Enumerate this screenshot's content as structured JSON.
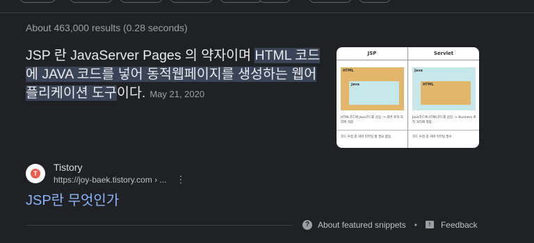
{
  "stats": "About 463,000 results (0.28 seconds)",
  "snippet": {
    "text_plain": "JSP 란 JavaServer Pages 의 약자이며 ",
    "text_highlight": "HTML 코드에 JAVA 코드를 넣어 동적웹페이지를 생성하는 웹어플리케이션 도구",
    "text_end": "이다.",
    "date": "May 21, 2020"
  },
  "thumbnail": {
    "left": {
      "header": "JSP",
      "outer_label": "HTML",
      "inner_label": "Java",
      "note": "HTML코드에 Java코드를 삽입 -> 화면 로직 처리에 적합",
      "footer": "코드 수정 후 서버 리부팅 할 필요 없음"
    },
    "right": {
      "header": "Servlet",
      "outer_label": "Java",
      "inner_label": "HTML",
      "note": "Java코드에 HTML코드를 삽입 -> Business 로직 처리에 적합",
      "footer": "코드 수정 후 서버 리부팅 필수"
    },
    "colors": {
      "orange": "#e2b66b",
      "cyan": "#c6e8ea"
    }
  },
  "source": {
    "site_name": "Tistory",
    "url": "https://joy-baek.tistory.com › ...",
    "favicon": "tistory-t",
    "more_icon": "⋮"
  },
  "result": {
    "title": "JSP란 무엇인가"
  },
  "footer": {
    "featured": "About featured snippets",
    "separator": "•",
    "feedback": "Feedback",
    "help_glyph": "?",
    "feedback_glyph": "!"
  }
}
